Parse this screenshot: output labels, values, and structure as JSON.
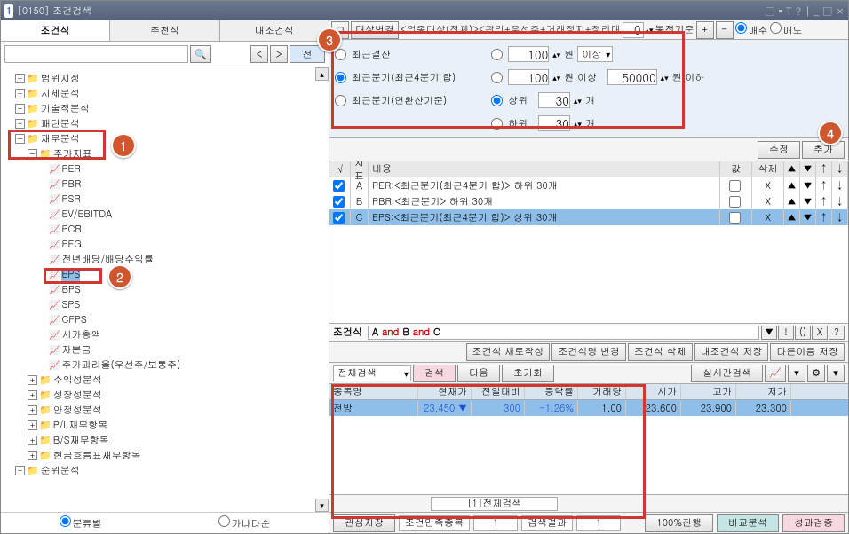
{
  "title": {
    "num": "1",
    "code": "[0150]",
    "name": "조건검색"
  },
  "win_controls": [
    "□",
    "▪",
    "T",
    "?",
    "|",
    "_",
    "□",
    "×"
  ],
  "left_tabs": [
    "조건식",
    "추천식",
    "내조건식"
  ],
  "left_toolbar": {
    "search_ph": "",
    "mag": "🔍",
    "prev": "<",
    "next": ">",
    "all": "전"
  },
  "tree": {
    "groups_top": [
      {
        "t": "범위지정",
        "exp": "+"
      },
      {
        "t": "시세분석",
        "exp": "+"
      },
      {
        "t": "기술적분석",
        "exp": "+"
      },
      {
        "t": "패턴분석",
        "exp": "+"
      }
    ],
    "fin_group": {
      "t": "재무분석",
      "exp": "−"
    },
    "price_group": {
      "t": "주가지표",
      "exp": "−"
    },
    "leaves": [
      "PER",
      "PBR",
      "PSR",
      "EV/EBITDA",
      "PCR",
      "PEG",
      "전년배당/배당수익률",
      "EPS",
      "BPS",
      "SPS",
      "CFPS",
      "시가총액",
      "자본금",
      "주가괴리율(우선주/보통주)"
    ],
    "groups_mid": [
      {
        "t": "수익성분석",
        "exp": "+"
      },
      {
        "t": "성장성분석",
        "exp": "+"
      },
      {
        "t": "안정성분석",
        "exp": "+"
      },
      {
        "t": "P/L재무항목",
        "exp": "+"
      },
      {
        "t": "B/S재무항목",
        "exp": "+"
      },
      {
        "t": "현금흐름표재무항목",
        "exp": "+"
      }
    ],
    "groups_bot": [
      {
        "t": "순위분석",
        "exp": "+"
      }
    ],
    "selected_leaf_index": 7
  },
  "bottom_radios": [
    "분류별",
    "가나다순"
  ],
  "top_path": {
    "label": "대상변경",
    "text": "<업종대상(전체)><관리+우선주+거래정지+정리매"
  },
  "top_right": {
    "val": "0",
    "label": "봉전기준",
    "plus": "+",
    "minus": "-",
    "buy": "매수",
    "sell": "매도"
  },
  "filter": {
    "radios": [
      "최근결산",
      "최근분기(최근4분기 합)",
      "최근분기(연환산기준)"
    ],
    "r1": {
      "v": "100",
      "unit": "원",
      "cmp": "이상"
    },
    "r2": {
      "v": "100",
      "unit": "원 이상",
      "v2": "50000",
      "unit2": "원 이하"
    },
    "r3": {
      "lbl": "상위",
      "v": "30",
      "unit": "개"
    },
    "r4": {
      "lbl": "하위",
      "v": "30",
      "unit": "개"
    }
  },
  "mod_btn": "수정",
  "add_btn": "추가",
  "cond_head": [
    "√",
    "지표",
    "내용",
    "값",
    "삭제",
    "",
    "",
    "",
    ""
  ],
  "cond_rows": [
    {
      "i": "A",
      "t": "PER:<최근분기(최근4분기 합)> 하위 30개"
    },
    {
      "i": "B",
      "t": "PBR:<최근분기> 하위 30개"
    },
    {
      "i": "C",
      "t": "EPS:<최근분기(최근4분기 합)> 상위 30개"
    }
  ],
  "cond_selected": 2,
  "formula": {
    "label": "조건식",
    "a": "A",
    "b": "B",
    "c": "C",
    "op": "and"
  },
  "formula_tools": [
    "▼",
    "!",
    "()",
    "X",
    "?"
  ],
  "cond_ops": [
    "조건식 새로작성",
    "조건식명 변경",
    "조건식 삭제",
    "내조건식 저장",
    "다른이름 저장"
  ],
  "search_bar": {
    "combo": "전체검색",
    "search": "검색",
    "next": "다음",
    "reset": "초기화",
    "rt": "실시간검색",
    "iconbtns": [
      "📈",
      "▾",
      "⚙",
      "▾"
    ]
  },
  "res_head": [
    "종목명",
    "현재가",
    "전일대비",
    "등락률",
    "거래량",
    "시가",
    "고가",
    "저가"
  ],
  "res_row": {
    "name": "전방",
    "price": "23,450",
    "arrow": "▼",
    "diff": "300",
    "pct": "-1.26%",
    "vol": "1,00",
    "open": "23,600",
    "high": "23,900",
    "low": "23,300"
  },
  "res_tab": "[1]전체검색",
  "bottom": {
    "save": "관심저장",
    "label1": "조건만족종목",
    "v1": "1",
    "label2": "검색결과",
    "v2": "1",
    "pct": "100%진행",
    "cmp": "비교분석",
    "ver": "성과검증"
  }
}
